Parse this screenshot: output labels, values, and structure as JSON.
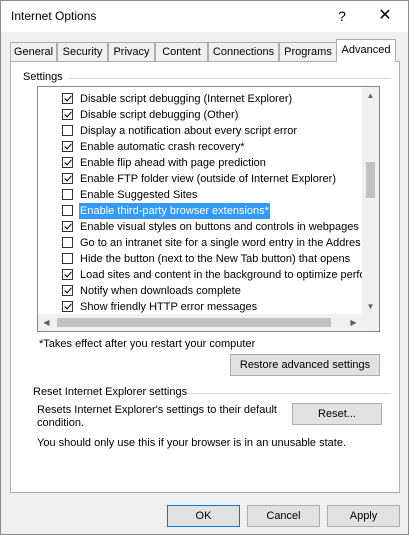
{
  "window": {
    "title": "Internet Options",
    "help_glyph": "?",
    "close_glyph": "✕"
  },
  "tabs": [
    {
      "label": "General",
      "active": false
    },
    {
      "label": "Security",
      "active": false
    },
    {
      "label": "Privacy",
      "active": false
    },
    {
      "label": "Content",
      "active": false
    },
    {
      "label": "Connections",
      "active": false
    },
    {
      "label": "Programs",
      "active": false
    },
    {
      "label": "Advanced",
      "active": true
    }
  ],
  "settings": {
    "group_label": "Settings",
    "items": [
      {
        "label": "Disable script debugging (Internet Explorer)",
        "checked": true,
        "selected": false
      },
      {
        "label": "Disable script debugging (Other)",
        "checked": true,
        "selected": false
      },
      {
        "label": "Display a notification about every script error",
        "checked": false,
        "selected": false
      },
      {
        "label": "Enable automatic crash recovery*",
        "checked": true,
        "selected": false
      },
      {
        "label": "Enable flip ahead with page prediction",
        "checked": true,
        "selected": false
      },
      {
        "label": "Enable FTP folder view (outside of Internet Explorer)",
        "checked": true,
        "selected": false
      },
      {
        "label": "Enable Suggested Sites",
        "checked": false,
        "selected": false
      },
      {
        "label": "Enable third-party browser extensions*",
        "checked": false,
        "selected": true
      },
      {
        "label": "Enable visual styles on buttons and controls in webpages",
        "checked": true,
        "selected": false
      },
      {
        "label": "Go to an intranet site for a single word entry in the Addres",
        "checked": false,
        "selected": false
      },
      {
        "label": "Hide the button (next to the New Tab button) that opens",
        "checked": false,
        "selected": false
      },
      {
        "label": "Load sites and content in the background to optimize perfo",
        "checked": true,
        "selected": false
      },
      {
        "label": "Notify when downloads complete",
        "checked": true,
        "selected": false
      },
      {
        "label": "Show friendly HTTP error messages",
        "checked": true,
        "selected": false
      }
    ],
    "note": "*Takes effect after you restart your computer",
    "restore_button": "Restore advanced settings"
  },
  "reset": {
    "group_label": "Reset Internet Explorer settings",
    "description": "Resets Internet Explorer's settings to their default condition.",
    "button": "Reset...",
    "warning": "You should only use this if your browser is in an unusable state."
  },
  "footer": {
    "ok": "OK",
    "cancel": "Cancel",
    "apply": "Apply"
  },
  "scroll_arrows": {
    "up": "▲",
    "down": "▼",
    "left": "◀",
    "right": "▶"
  }
}
